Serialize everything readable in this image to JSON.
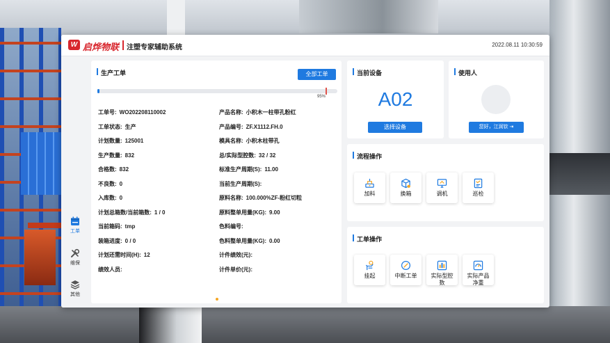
{
  "header": {
    "brand": "启烨物联",
    "title": "注塑专家辅助系统",
    "datetime": "2022.08.11 10:30:59"
  },
  "nav": [
    {
      "label": "工单",
      "icon": "calendar-icon",
      "active": true
    },
    {
      "label": "维保",
      "icon": "tools-icon",
      "active": false
    },
    {
      "label": "其他",
      "icon": "layers-icon",
      "active": false
    }
  ],
  "work_order": {
    "title": "生产工单",
    "all_button": "全部工单",
    "progress_percent": 95,
    "progress_label": "95%",
    "left_fields": [
      {
        "label": "工单号:",
        "value": "WO202208110002"
      },
      {
        "label": "工单状态:",
        "value": "生产"
      },
      {
        "label": "计划数量:",
        "value": "125001"
      },
      {
        "label": "生产数量:",
        "value": "832"
      },
      {
        "label": "合格数:",
        "value": "832"
      },
      {
        "label": "不良数:",
        "value": "0"
      },
      {
        "label": "入库数:",
        "value": "0"
      },
      {
        "label": "计划总箱数/当前箱数:",
        "value": "1 / 0"
      },
      {
        "label": "当前箱码:",
        "value": "tmp"
      },
      {
        "label": "装箱进度:",
        "value": "0 / 0"
      },
      {
        "label": "计划还需时间(H):",
        "value": "12"
      },
      {
        "label": "绩效人员:",
        "value": ""
      }
    ],
    "right_fields": [
      {
        "label": "产品名称:",
        "value": "小积木一柱带孔粉红"
      },
      {
        "label": "产品编号:",
        "value": "ZF.X1112.FH.0"
      },
      {
        "label": "模具名称:",
        "value": "小积木柱带孔"
      },
      {
        "label": "总/实际型腔数:",
        "value": "32 / 32"
      },
      {
        "label": "标准生产周期(S):",
        "value": "11.00"
      },
      {
        "label": "当前生产周期(S):",
        "value": ""
      },
      {
        "label": "原料名称:",
        "value": "100.000%ZF-粉红切粒"
      },
      {
        "label": "原料整单用量(KG):",
        "value": "9.00"
      },
      {
        "label": "色料编号:",
        "value": ""
      },
      {
        "label": "色料整单用量(KG):",
        "value": "0.00"
      },
      {
        "label": "计件绩效(元):",
        "value": ""
      },
      {
        "label": "计件单价(元):",
        "value": ""
      }
    ]
  },
  "device": {
    "title": "当前设备",
    "code": "A02",
    "select_button": "选择设备"
  },
  "user": {
    "title": "使用人",
    "greeting_button": "您好，江润钦 ⇥"
  },
  "flow": {
    "title": "流程操作",
    "tiles": [
      {
        "label": "加料",
        "icon": "feed-icon"
      },
      {
        "label": "换箱",
        "icon": "box-icon"
      },
      {
        "label": "调机",
        "icon": "monitor-icon"
      },
      {
        "label": "巡检",
        "icon": "checklist-icon"
      }
    ]
  },
  "ops": {
    "title": "工单操作",
    "tiles": [
      {
        "label": "挂起",
        "icon": "hand-icon"
      },
      {
        "label": "中断工单",
        "icon": "pause-icon"
      },
      {
        "label": "实际型腔数",
        "line1": "实际型腔",
        "line2": "数",
        "icon": "bar-chart-icon"
      },
      {
        "label": "实际产品净重",
        "line1": "实际产品",
        "line2": "净重",
        "icon": "gauge-icon"
      }
    ]
  },
  "colors": {
    "accent": "#1f7ae0",
    "brand": "#d8262d",
    "progress_marker": "#e0524a",
    "icon_orange": "#f5a623"
  }
}
